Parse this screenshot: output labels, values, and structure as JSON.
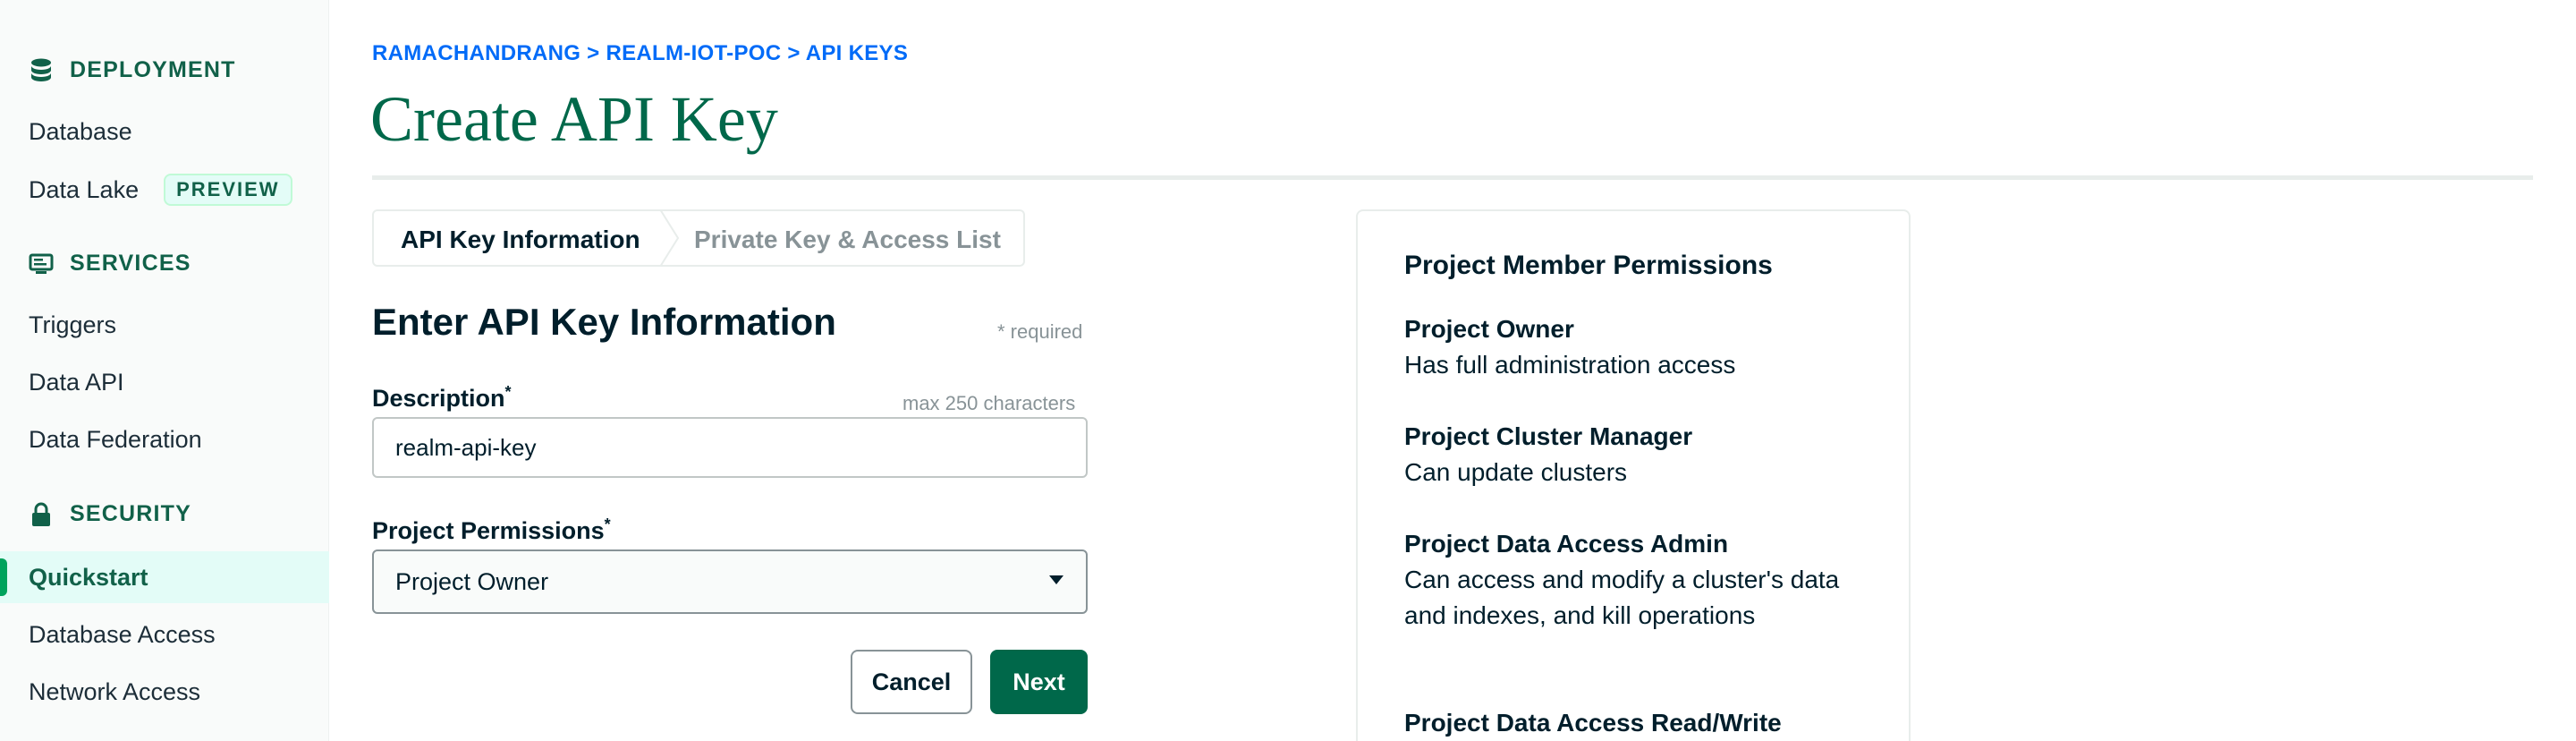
{
  "sidebar": {
    "sections": [
      {
        "title": "DEPLOYMENT",
        "icon": "database-icon"
      },
      {
        "title": "SERVICES",
        "icon": "services-icon"
      },
      {
        "title": "SECURITY",
        "icon": "lock-icon"
      }
    ],
    "items": {
      "database": "Database",
      "data_lake": "Data Lake",
      "data_lake_badge": "PREVIEW",
      "triggers": "Triggers",
      "data_api": "Data API",
      "data_federation": "Data Federation",
      "quickstart": "Quickstart",
      "database_access": "Database Access",
      "network_access": "Network Access"
    }
  },
  "breadcrumb": "RAMACHANDRANG > REALM-IOT-POC > API KEYS",
  "page_title": "Create API Key",
  "stepper": {
    "step1": "API Key Information",
    "step2": "Private Key & Access List"
  },
  "form": {
    "heading": "Enter API Key Information",
    "required_note": "* required",
    "description_label": "Description",
    "description_hint": "max 250 characters",
    "description_value": "realm-api-key",
    "permissions_label": "Project Permissions",
    "permissions_value": "Project Owner",
    "required_mark": "*",
    "cancel_label": "Cancel",
    "next_label": "Next"
  },
  "permissions_panel": {
    "title": "Project Member Permissions",
    "roles": [
      {
        "name": "Project Owner",
        "desc": "Has full administration access"
      },
      {
        "name": "Project Cluster Manager",
        "desc": "Can update clusters"
      },
      {
        "name": "Project Data Access Admin",
        "desc": "Can access and modify a cluster's data and indexes, and kill operations"
      },
      {
        "name": "Project Data Access Read/Write",
        "desc": ""
      }
    ]
  },
  "colors": {
    "accent_green": "#00684a",
    "link_blue": "#016bf8",
    "active_bg": "#e3fcf7"
  }
}
